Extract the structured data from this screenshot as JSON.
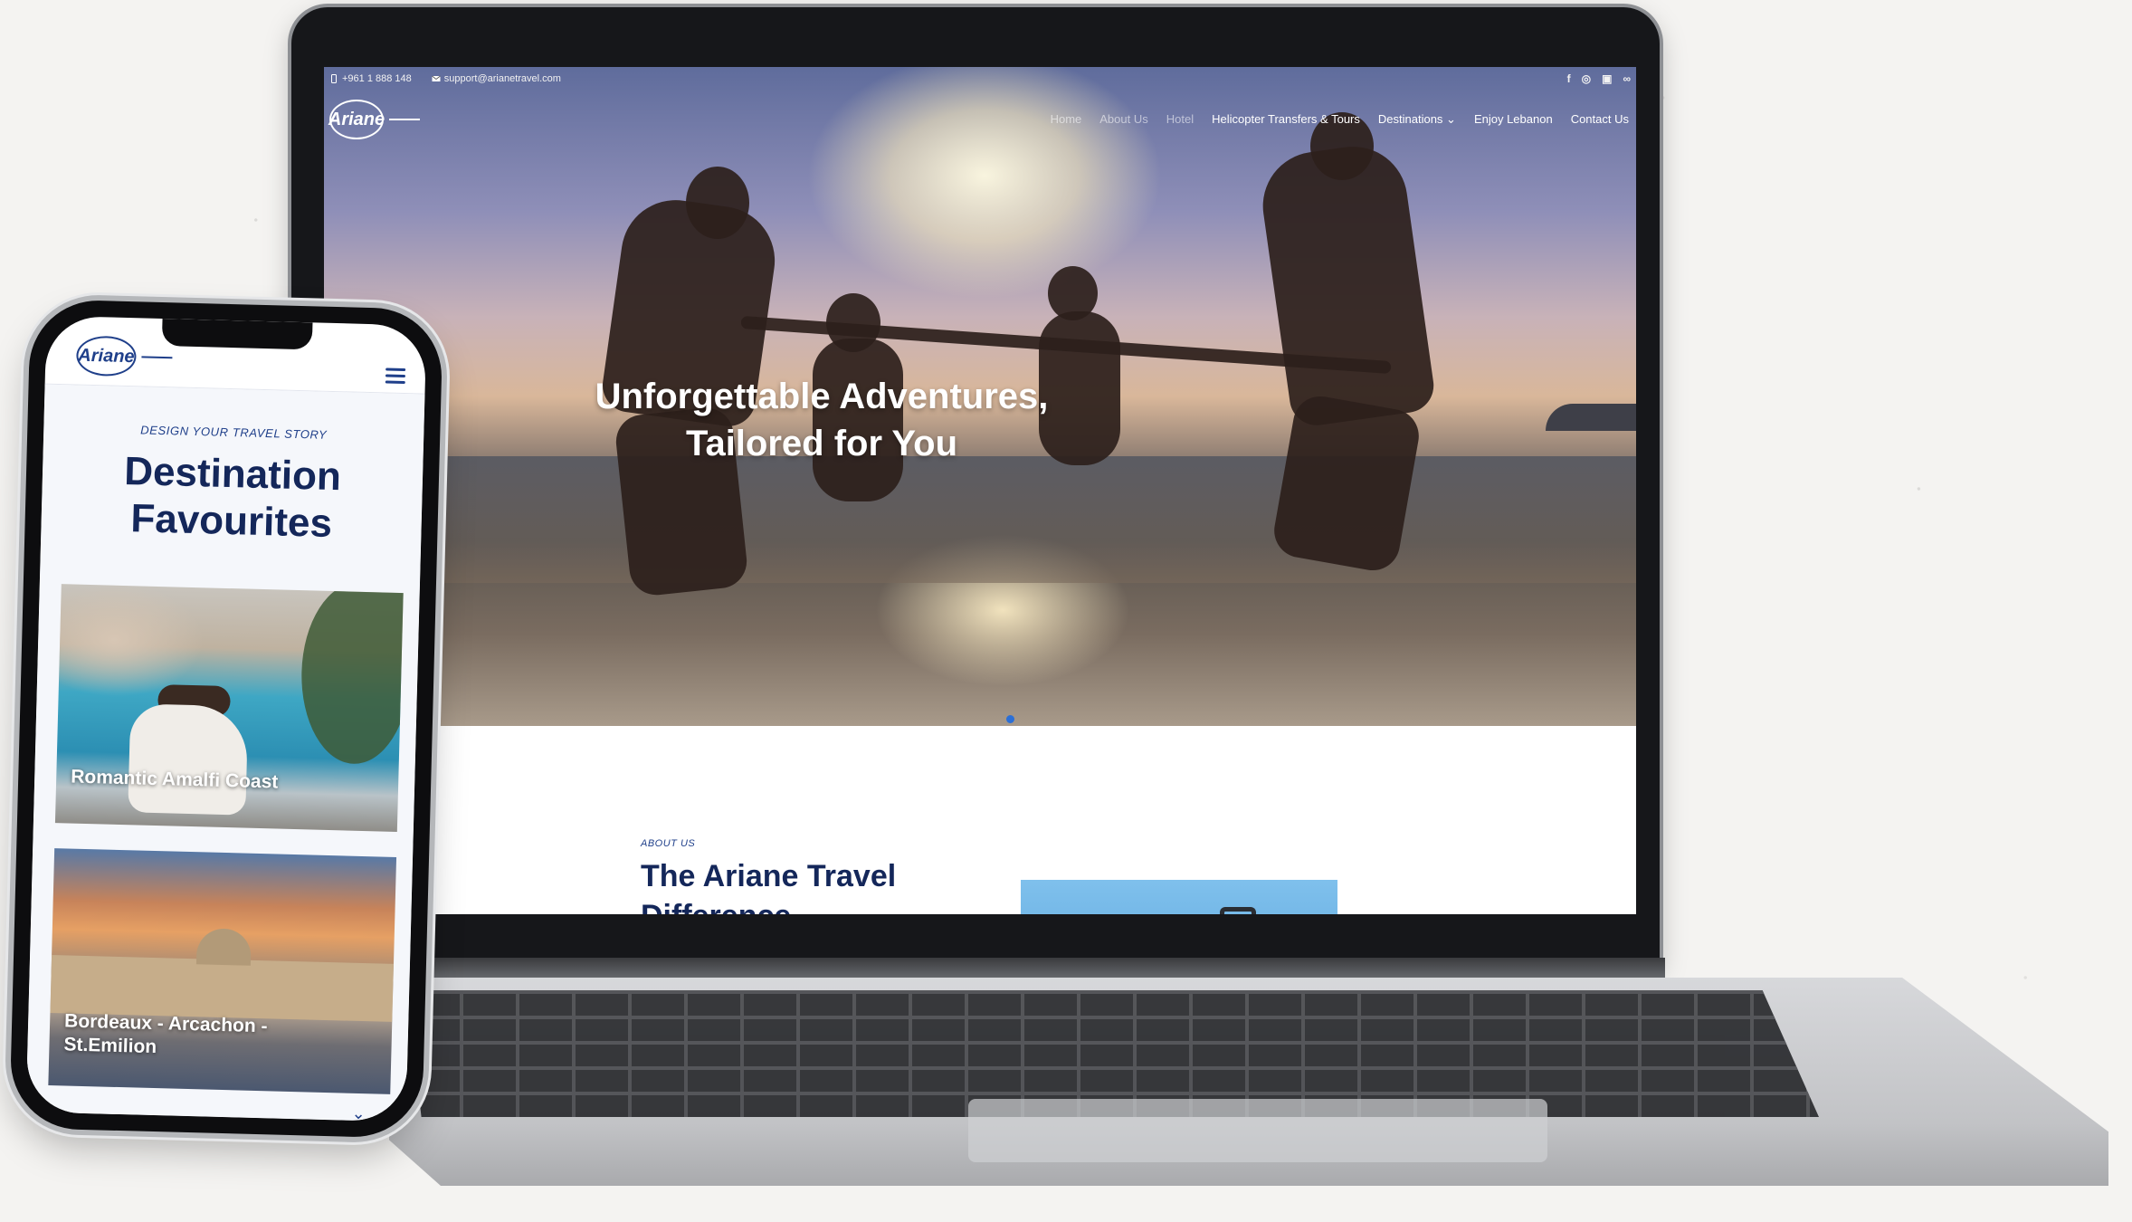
{
  "laptop_site": {
    "topbar": {
      "phone": "+961 1 888 148",
      "email": "support@arianetravel.com",
      "socials": [
        "facebook-icon",
        "instagram-icon",
        "linkedin-icon",
        "tripadvisor-icon"
      ]
    },
    "logo": "Ariane",
    "nav": [
      "Home",
      "About Us",
      "Hotel",
      "Helicopter Transfers & Tours",
      "Destinations ⌄",
      "Enjoy Lebanon",
      "Contact Us"
    ],
    "hero_title_line1": "Unforgettable Adventures,",
    "hero_title_line2": "Tailored for You",
    "about_kicker": "ABOUT US",
    "about_title_line1": "The Ariane Travel",
    "about_title_line2": "Difference"
  },
  "phone_site": {
    "logo": "Ariane",
    "kicker": "DESIGN YOUR TRAVEL STORY",
    "title_line1": "Destination",
    "title_line2": "Favourites",
    "cards": [
      {
        "label": "Romantic Amalfi Coast"
      },
      {
        "label_line1": "Bordeaux - Arcachon -",
        "label_line2": "St.Emilion"
      }
    ],
    "chevron": "⌄"
  },
  "colors": {
    "brand_navy": "#14275a",
    "brand_blue": "#1f3f8a",
    "accent_dot": "#2b6fd6"
  }
}
